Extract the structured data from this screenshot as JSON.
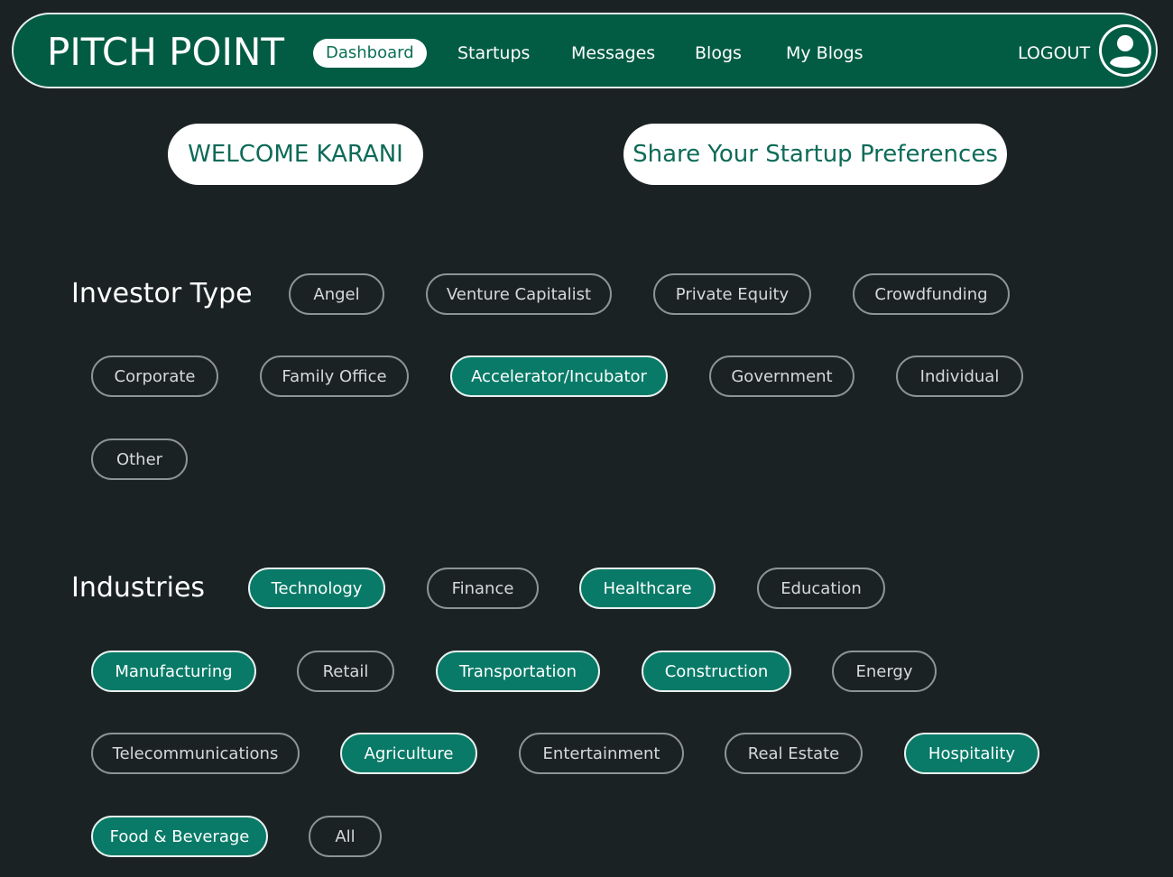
{
  "app": {
    "brand": "PITCH POINT"
  },
  "nav": {
    "items": [
      {
        "label": "Dashboard",
        "active": true
      },
      {
        "label": "Startups",
        "active": false
      },
      {
        "label": "Messages",
        "active": false
      },
      {
        "label": "Blogs",
        "active": false
      },
      {
        "label": "My Blogs",
        "active": false
      }
    ],
    "logout": "LOGOUT",
    "avatar_icon": "user-circle-icon"
  },
  "header": {
    "welcome": "WELCOME KARANI",
    "share": "Share Your Startup Preferences"
  },
  "investor_type": {
    "title": "Investor Type",
    "options": [
      {
        "label": "Angel",
        "selected": false
      },
      {
        "label": "Venture Capitalist",
        "selected": false
      },
      {
        "label": "Private Equity",
        "selected": false
      },
      {
        "label": "Crowdfunding",
        "selected": false
      },
      {
        "label": "Corporate",
        "selected": false
      },
      {
        "label": "Family Office",
        "selected": false
      },
      {
        "label": "Accelerator/Incubator",
        "selected": true
      },
      {
        "label": "Government",
        "selected": false
      },
      {
        "label": "Individual",
        "selected": false
      },
      {
        "label": "Other",
        "selected": false
      }
    ]
  },
  "industries": {
    "title": "Industries",
    "options": [
      {
        "label": "Technology",
        "selected": true
      },
      {
        "label": "Finance",
        "selected": false
      },
      {
        "label": "Healthcare",
        "selected": true
      },
      {
        "label": "Education",
        "selected": false
      },
      {
        "label": "Manufacturing",
        "selected": true
      },
      {
        "label": "Retail",
        "selected": false
      },
      {
        "label": "Transportation",
        "selected": true
      },
      {
        "label": "Construction",
        "selected": true
      },
      {
        "label": "Energy",
        "selected": false
      },
      {
        "label": "Telecommunications",
        "selected": false
      },
      {
        "label": "Agriculture",
        "selected": true
      },
      {
        "label": "Entertainment",
        "selected": false
      },
      {
        "label": "Real Estate",
        "selected": false
      },
      {
        "label": "Hospitality",
        "selected": true
      },
      {
        "label": "Food & Beverage",
        "selected": true
      },
      {
        "label": "All",
        "selected": false
      }
    ]
  },
  "colors": {
    "background": "#1b2224",
    "navbar": "#025c43",
    "accent": "#087a67",
    "accent_text": "#0d6b58"
  }
}
